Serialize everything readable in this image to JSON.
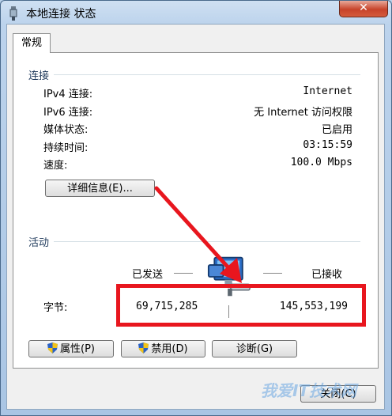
{
  "window": {
    "title": "本地连接 状态",
    "close_label": "✕"
  },
  "tab": {
    "label": "常规"
  },
  "connection": {
    "heading": "连接",
    "rows": [
      {
        "label": "IPv4 连接:",
        "value": "Internet"
      },
      {
        "label": "IPv6 连接:",
        "value": "无 Internet 访问权限"
      },
      {
        "label": "媒体状态:",
        "value": "已启用"
      },
      {
        "label": "持续时间:",
        "value": "03:15:59"
      },
      {
        "label": "速度:",
        "value": "100.0 Mbps"
      }
    ],
    "details_button": "详细信息(E)..."
  },
  "activity": {
    "heading": "活动",
    "sent_label": "已发送",
    "received_label": "已接收",
    "bytes_label": "字节:",
    "bytes_sent": "69,715,285",
    "bytes_received": "145,553,199"
  },
  "buttons": {
    "properties": "属性(P)",
    "disable": "禁用(D)",
    "diagnose": "诊断(G)",
    "close": "关闭(C)"
  },
  "watermark": {
    "text": "我爱IT技术网"
  },
  "colors": {
    "highlight": "#e8161e",
    "arrow": "#e8161e",
    "heading": "#1e395b"
  }
}
